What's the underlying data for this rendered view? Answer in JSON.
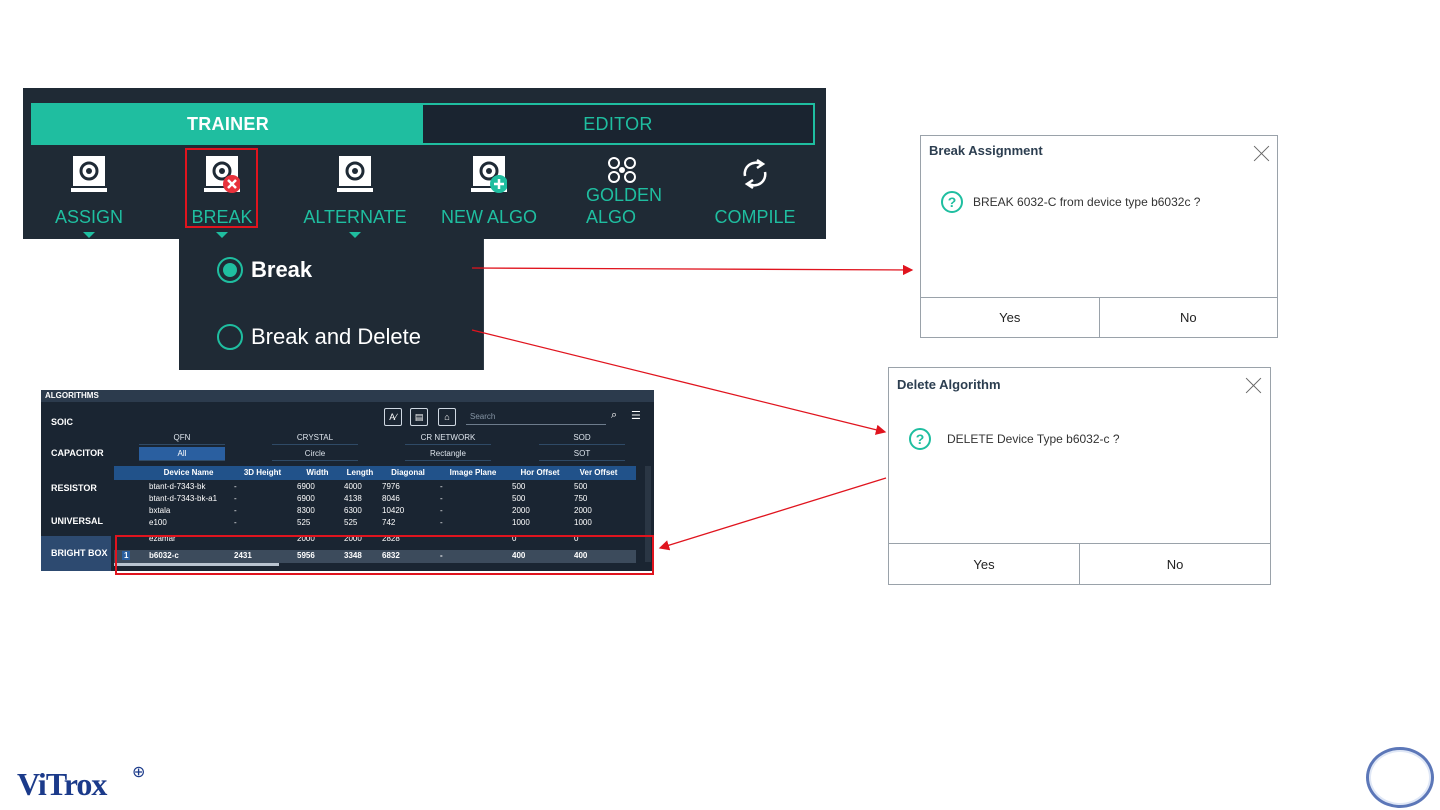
{
  "toolbar": {
    "tabs": {
      "trainer": "TRAINER",
      "editor": "EDITOR"
    },
    "tools": {
      "assign": "ASSIGN",
      "break": "BREAK",
      "alternate": "ALTERNATE",
      "new_algo": "NEW ALGO",
      "golden_line1": "GOLDEN",
      "golden_line2": "ALGO",
      "compile": "COMPILE"
    }
  },
  "break_menu": {
    "options": [
      "Break",
      "Break and Delete"
    ],
    "selected": "Break"
  },
  "algorithms": {
    "header": "ALGORITHMS",
    "categories": [
      "SOIC",
      "CAPACITOR",
      "RESISTOR",
      "UNIVERSAL",
      "BRIGHT BOX"
    ],
    "selected_category": "BRIGHT BOX",
    "search_placeholder": "Search",
    "subtypes_row1": [
      "QFN",
      "CRYSTAL",
      "CR NETWORK",
      "SOD"
    ],
    "subtypes_row2": [
      "All",
      "Circle",
      "Rectangle",
      "SOT"
    ],
    "selected_subtype": "All",
    "columns": [
      "Device Name",
      "3D Height",
      "Width",
      "Length",
      "Diagonal",
      "Image Plane",
      "Hor Offset",
      "Ver Offset"
    ],
    "rows": [
      [
        "btant-d-7343-bk",
        "-",
        "6900",
        "4000",
        "7976",
        "-",
        "500",
        "500"
      ],
      [
        "btant-d-7343-bk-a1",
        "-",
        "6900",
        "4138",
        "8046",
        "-",
        "500",
        "750"
      ],
      [
        "bxtala",
        "-",
        "8300",
        "6300",
        "10420",
        "-",
        "2000",
        "2000"
      ],
      [
        "e100",
        "-",
        "525",
        "525",
        "742",
        "-",
        "1000",
        "1000"
      ]
    ],
    "partial_row": [
      "ezamar",
      "",
      "2000",
      "2000",
      "2828",
      "",
      "0",
      "0"
    ],
    "selected_row": {
      "index": "1",
      "cells": [
        "b6032-c",
        "2431",
        "5956",
        "3348",
        "6832",
        "-",
        "400",
        "400"
      ]
    }
  },
  "dialogs": {
    "break": {
      "title": "Break Assignment",
      "message": "BREAK 6032-C from device type b6032c ?",
      "yes": "Yes",
      "no": "No"
    },
    "delete": {
      "title": "Delete Algorithm",
      "message": "DELETE Device Type b6032-c ?",
      "yes": "Yes",
      "no": "No"
    }
  },
  "footer": {
    "logo": "ViTrox",
    "logo_mark": "⊕"
  },
  "colors": {
    "accent": "#1fbea0",
    "panel": "#1f2a35",
    "highlight": "#e0141e",
    "brand": "#1b3a8a"
  }
}
